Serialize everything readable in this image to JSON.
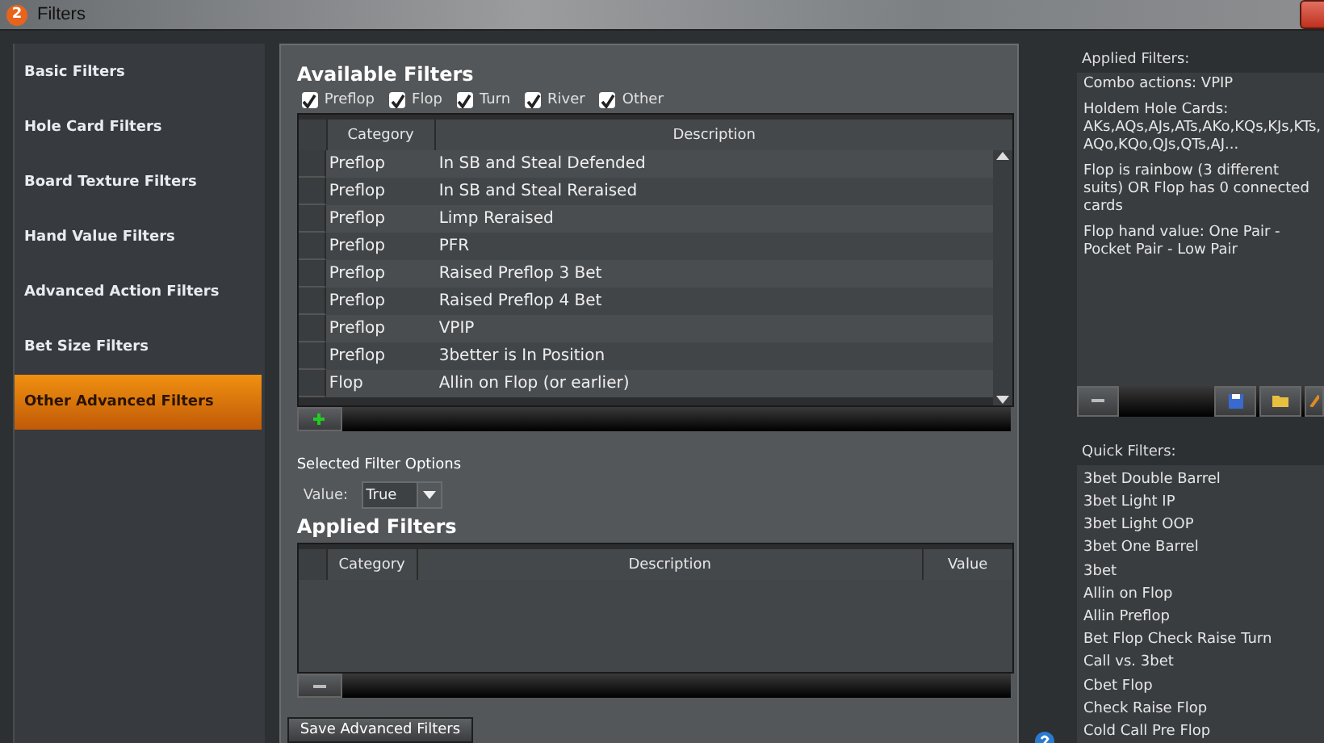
{
  "window": {
    "logo_text": "2",
    "title": "Filters"
  },
  "sidebar": {
    "items": [
      {
        "label": "Basic Filters",
        "selected": false
      },
      {
        "label": "Hole Card Filters",
        "selected": false
      },
      {
        "label": "Board Texture Filters",
        "selected": false
      },
      {
        "label": "Hand Value Filters",
        "selected": false
      },
      {
        "label": "Advanced Action Filters",
        "selected": false
      },
      {
        "label": "Bet Size Filters",
        "selected": false
      },
      {
        "label": "Other Advanced Filters",
        "selected": true
      }
    ]
  },
  "available": {
    "title": "Available Filters",
    "streets": [
      {
        "label": "Preflop",
        "checked": true
      },
      {
        "label": "Flop",
        "checked": true
      },
      {
        "label": "Turn",
        "checked": true
      },
      {
        "label": "River",
        "checked": true
      },
      {
        "label": "Other",
        "checked": true
      }
    ],
    "columns": [
      "Category",
      "Description"
    ],
    "rows": [
      [
        "Preflop",
        "In SB and Steal Defended"
      ],
      [
        "Preflop",
        "In SB and Steal Reraised"
      ],
      [
        "Preflop",
        "Limp Reraised"
      ],
      [
        "Preflop",
        "PFR"
      ],
      [
        "Preflop",
        "Raised Preflop 3 Bet"
      ],
      [
        "Preflop",
        "Raised Preflop 4 Bet"
      ],
      [
        "Preflop",
        "VPIP"
      ],
      [
        "Preflop",
        "3better is In Position"
      ],
      [
        "Flop",
        "Allin on Flop (or earlier)"
      ]
    ]
  },
  "options": {
    "title": "Selected Filter Options",
    "value_label": "Value:",
    "value": "True"
  },
  "applied": {
    "title": "Applied Filters",
    "columns": [
      "Category",
      "Description",
      "Value"
    ]
  },
  "save_button": "Save Advanced Filters",
  "right": {
    "applied_title": "Applied Filters:",
    "applied_items": [
      "Combo actions: VPIP",
      "Holdem Hole Cards: AKs,AQs,AJs,ATs,AKo,KQs,KJs,KTs, AQo,KQo,QJs,QTs,AJ...",
      "Flop is rainbow (3 different suits) OR Flop has 0 connected cards",
      "Flop hand value: One Pair - Pocket Pair - Low Pair"
    ],
    "quick_title": "Quick Filters:",
    "quick_items": [
      "3bet Double Barrel",
      "3bet Light IP",
      "3bet Light OOP",
      "3bet One Barrel",
      "3bet",
      "Allin on Flop",
      "Allin Preflop",
      "Bet Flop Check Raise Turn",
      "Call vs. 3bet",
      "Cbet Flop",
      "Check Raise Flop",
      "Cold Call Pre Flop"
    ]
  }
}
